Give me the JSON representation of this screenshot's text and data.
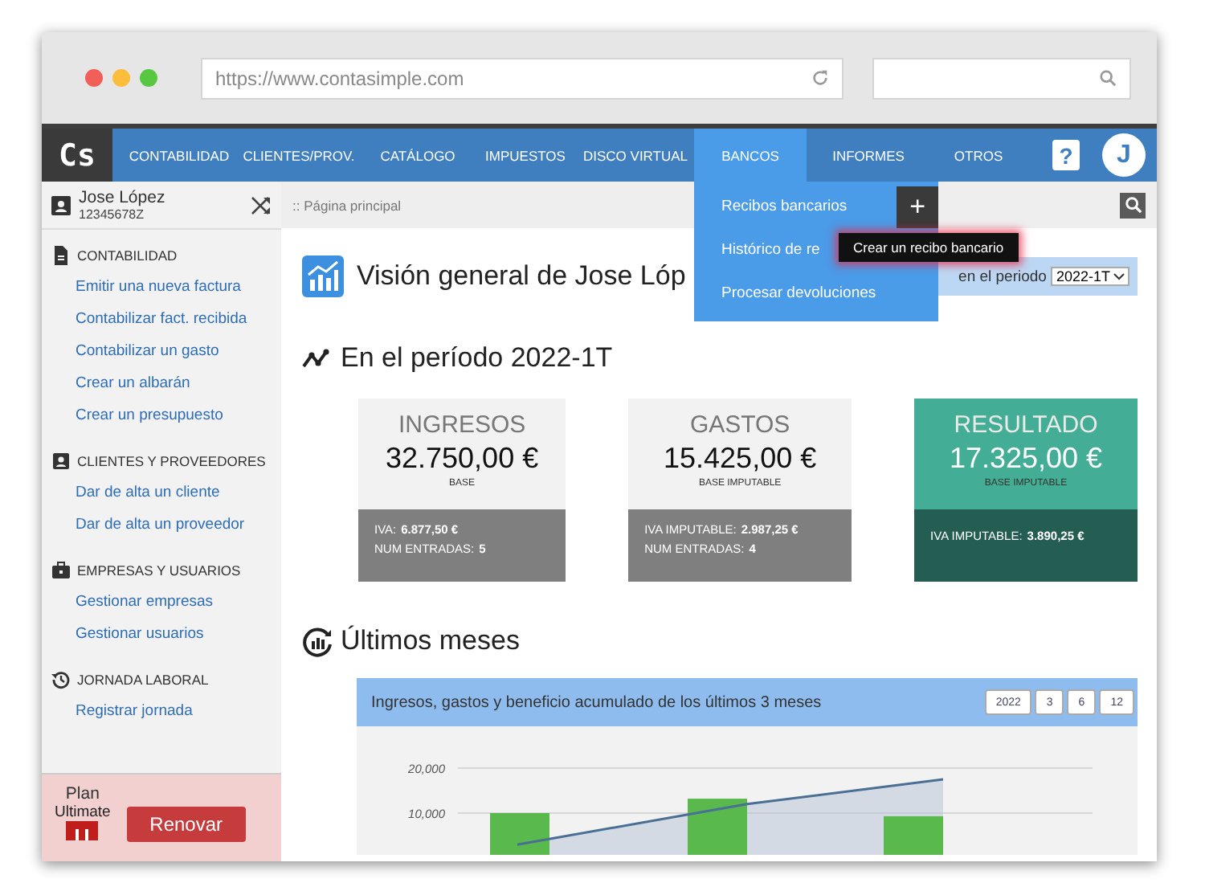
{
  "browser": {
    "url": "https://www.contasimple.com"
  },
  "nav": {
    "logo": "Cs",
    "items": [
      {
        "label": "CONTABILIDAD",
        "selected": false
      },
      {
        "label": "CLIENTES/PROV.",
        "selected": false
      },
      {
        "label": "CATÁLOGO",
        "selected": false
      },
      {
        "label": "IMPUESTOS",
        "selected": false
      },
      {
        "label": "DISCO VIRTUAL",
        "selected": false
      },
      {
        "label": "BANCOS",
        "selected": true
      },
      {
        "label": "INFORMES",
        "selected": false
      },
      {
        "label": "OTROS",
        "selected": false
      }
    ],
    "help": "?",
    "avatar": "J"
  },
  "dropdown": {
    "items": [
      {
        "label": "Recibos bancarios",
        "add": "+"
      },
      {
        "label": "Histórico de re"
      },
      {
        "label": "Procesar devoluciones"
      }
    ],
    "tooltip": "Crear un recibo bancario"
  },
  "user": {
    "name": "Jose López",
    "id": "12345678Z"
  },
  "breadcrumb": ":: Página principal",
  "sidebar": {
    "sections": [
      {
        "kind": "document",
        "title": "CONTABILIDAD",
        "links": [
          "Emitir una nueva factura",
          "Contabilizar fact. recibida",
          "Contabilizar un gasto",
          "Crear un albarán",
          "Crear un presupuesto"
        ]
      },
      {
        "kind": "contacts",
        "title": "CLIENTES Y PROVEEDORES",
        "links": [
          "Dar de alta un cliente",
          "Dar de alta un proveedor"
        ]
      },
      {
        "kind": "briefcase",
        "title": "EMPRESAS Y USUARIOS",
        "links": [
          "Gestionar empresas",
          "Gestionar usuarios"
        ]
      },
      {
        "kind": "history",
        "title": "JORNADA LABORAL",
        "links": [
          "Registrar jornada"
        ]
      }
    ]
  },
  "plan": {
    "label": "Plan",
    "name": "Ultimate",
    "button": "Renovar"
  },
  "overview": {
    "title": "Visión general de Jose Lóp",
    "period_label": "en el periodo",
    "period": "2022-1T"
  },
  "period_section": {
    "title": "En el período 2022-1T",
    "cards": [
      {
        "kind": "neutral",
        "title": "INGRESOS",
        "amount": "32.750,00 €",
        "caption": "BASE",
        "details": [
          {
            "label": "IVA:",
            "value": "6.877,50 €"
          },
          {
            "label": "NUM ENTRADAS:",
            "value": "5"
          }
        ]
      },
      {
        "kind": "neutral",
        "title": "GASTOS",
        "amount": "15.425,00 €",
        "caption": "BASE IMPUTABLE",
        "details": [
          {
            "label": "IVA IMPUTABLE:",
            "value": "2.987,25 €"
          },
          {
            "label": "NUM ENTRADAS:",
            "value": "4"
          }
        ]
      },
      {
        "kind": "result",
        "title": "RESULTADO",
        "amount": "17.325,00 €",
        "caption": "BASE IMPUTABLE",
        "details": [
          {
            "label": "IVA IMPUTABLE:",
            "value": "3.890,25 €"
          }
        ]
      }
    ]
  },
  "recent": {
    "title": "Últimos meses",
    "chart": {
      "title": "Ingresos, gastos y beneficio acumulado de los últimos 3 meses",
      "ranges": [
        "2022",
        "3",
        "6",
        "12"
      ],
      "chart_data": {
        "type": "bar",
        "stacked": false,
        "ylim": [
          0,
          20000
        ],
        "yticks": [
          {
            "value": 10000,
            "label": "10,000"
          },
          {
            "value": 20000,
            "label": "20,000"
          }
        ],
        "series": [
          {
            "type": "bar",
            "color": "#5ab94c",
            "values": [
              10000,
              13200,
              9300
            ]
          },
          {
            "type": "area",
            "color": "#4a6f95",
            "values": [
              3000,
              12000,
              17500
            ]
          }
        ]
      }
    }
  }
}
